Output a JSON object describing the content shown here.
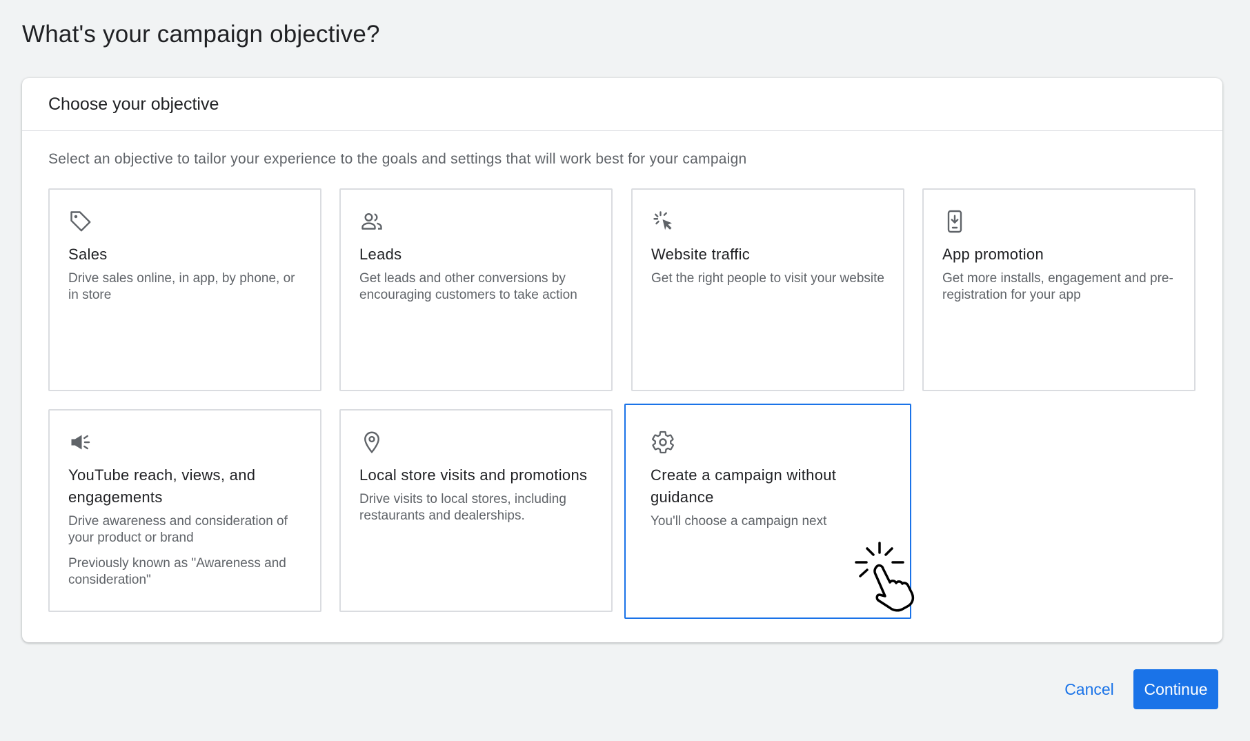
{
  "page": {
    "title": "What's your campaign objective?"
  },
  "panel": {
    "header": "Choose your objective",
    "instruction": "Select an objective to tailor your experience to the goals and settings that will work best for your campaign"
  },
  "objectives": [
    {
      "icon": "tag-icon",
      "title": "Sales",
      "description": "Drive sales online, in app, by phone, or in store",
      "note": ""
    },
    {
      "icon": "people-icon",
      "title": "Leads",
      "description": "Get leads and other conversions by encouraging customers to take action",
      "note": ""
    },
    {
      "icon": "cursor-click-icon",
      "title": "Website traffic",
      "description": "Get the right people to visit your website",
      "note": ""
    },
    {
      "icon": "phone-download-icon",
      "title": "App promotion",
      "description": "Get more installs, engagement and pre-registration for your app",
      "note": ""
    },
    {
      "icon": "megaphone-icon",
      "title": "YouTube reach, views, and engagements",
      "description": "Drive awareness and consideration of your product or brand",
      "note": "Previously known as \"Awareness and consideration\""
    },
    {
      "icon": "location-pin-icon",
      "title": "Local store visits and promotions",
      "description": "Drive visits to local stores, including restaurants and dealerships.",
      "note": ""
    },
    {
      "icon": "gear-icon",
      "title": "Create a campaign without guidance",
      "description": "You'll choose a campaign next",
      "note": "",
      "selected": true
    }
  ],
  "footer": {
    "cancel": "Cancel",
    "continue": "Continue"
  },
  "colors": {
    "accent": "#1a73e8",
    "background": "#f1f3f4",
    "text": "#202124",
    "secondary_text": "#5f6368",
    "border": "#dadce0"
  }
}
